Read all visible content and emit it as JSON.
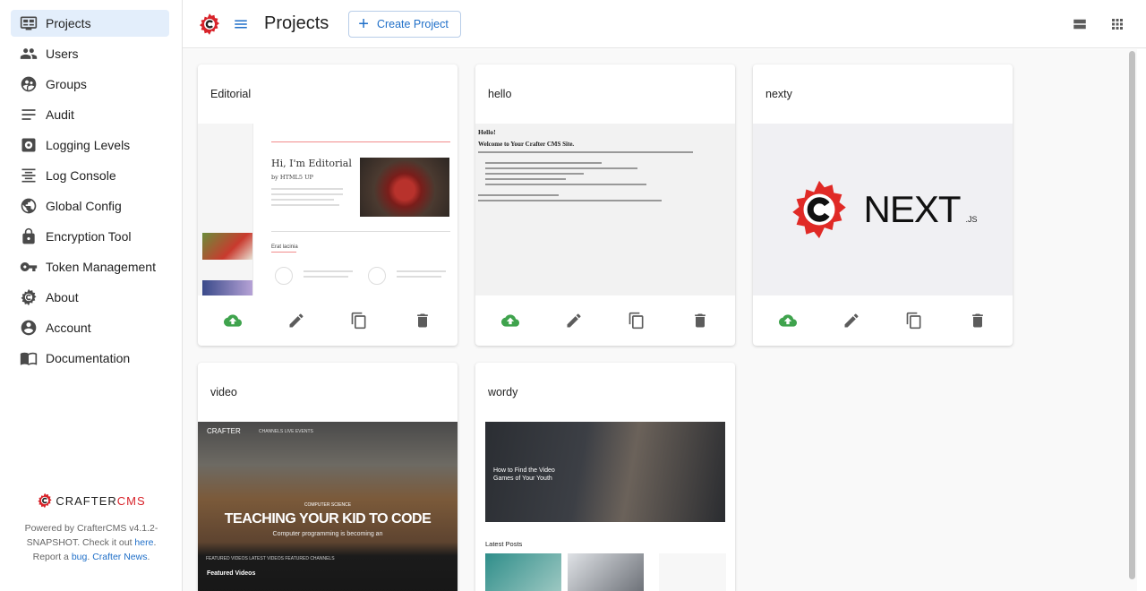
{
  "colors": {
    "accent": "#1f6fc8",
    "brand_red": "#d8232a",
    "publish_green": "#3fa34d"
  },
  "sidebar": {
    "items": [
      {
        "label": "Projects",
        "icon": "projects-icon",
        "active": true
      },
      {
        "label": "Users",
        "icon": "users-icon"
      },
      {
        "label": "Groups",
        "icon": "groups-icon"
      },
      {
        "label": "Audit",
        "icon": "audit-icon"
      },
      {
        "label": "Logging Levels",
        "icon": "logging-levels-icon"
      },
      {
        "label": "Log Console",
        "icon": "log-console-icon"
      },
      {
        "label": "Global Config",
        "icon": "globe-icon"
      },
      {
        "label": "Encryption Tool",
        "icon": "lock-icon"
      },
      {
        "label": "Token Management",
        "icon": "key-icon"
      },
      {
        "label": "About",
        "icon": "crafter-icon"
      },
      {
        "label": "Account",
        "icon": "account-icon"
      },
      {
        "label": "Documentation",
        "icon": "book-icon"
      }
    ],
    "footer": {
      "logo_text_a": "CRAFTER",
      "logo_text_b": "CMS",
      "text_1": "Powered by CrafterCMS v4.1.2-SNAPSHOT. Check it out ",
      "link_here": "here",
      "text_2": ". Report a ",
      "link_bug": "bug",
      "text_3": ". ",
      "link_news": "Crafter News",
      "text_4": "."
    }
  },
  "topbar": {
    "title": "Projects",
    "create_label": "Create Project"
  },
  "projects": [
    {
      "name": "Editorial"
    },
    {
      "name": "hello"
    },
    {
      "name": "nexty"
    },
    {
      "name": "video"
    },
    {
      "name": "wordy"
    }
  ],
  "thumbs": {
    "editorial": {
      "heading": "Hi, I'm Editorial",
      "byline": "by HTML5 UP",
      "section": "Erat lacinia"
    },
    "hello": {
      "h1": "Hello!",
      "h2": "Welcome to Your Crafter CMS Site."
    },
    "nexty": {
      "word": "NEXT",
      "suffix": ".JS"
    },
    "video": {
      "logo": "CRAFTER",
      "nav": "CHANNELS     LIVE EVENTS",
      "kicker": "COMPUTER SCIENCE",
      "headline": "TEACHING YOUR KID TO CODE",
      "subline": "Computer programming is becoming an",
      "tabs": "FEATURED VIDEOS     LATEST VIDEOS     FEATURED CHANNELS",
      "featured": "Featured Videos"
    },
    "wordy": {
      "hero": "How to Find the Video Games of Your Youth",
      "latest": "Latest Posts"
    }
  }
}
